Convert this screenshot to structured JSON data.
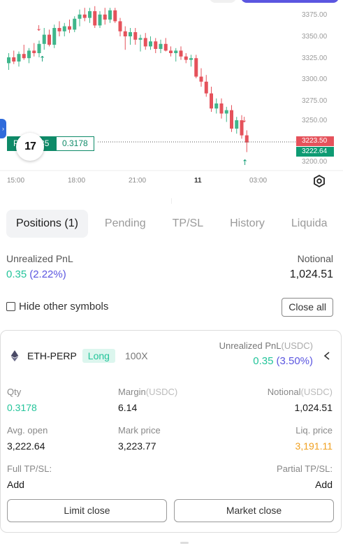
{
  "chart": {
    "price_ticks": [
      "3375.00",
      "3350.00",
      "3325.00",
      "3300.00",
      "3275.00",
      "3250.00",
      "3200.00"
    ],
    "time_ticks": [
      "15:00",
      "18:00",
      "21:00",
      "11",
      "03:00"
    ],
    "mark_price_tag": "3223.50",
    "entry_price_tag": "3222.64",
    "position_label_pnl": "P",
    "position_label_pnl_tail": "35",
    "position_label_qty": "0.3178",
    "logo_text": "17",
    "colors": {
      "up": "#3fb68b",
      "down": "#e5525b"
    },
    "series": [
      {
        "o": 3318,
        "h": 3330,
        "l": 3310,
        "c": 3325
      },
      {
        "o": 3325,
        "h": 3333,
        "l": 3317,
        "c": 3320
      },
      {
        "o": 3320,
        "h": 3332,
        "l": 3314,
        "c": 3329
      },
      {
        "o": 3329,
        "h": 3340,
        "l": 3322,
        "c": 3324
      },
      {
        "o": 3324,
        "h": 3336,
        "l": 3318,
        "c": 3333
      },
      {
        "o": 3333,
        "h": 3342,
        "l": 3326,
        "c": 3330
      },
      {
        "o": 3330,
        "h": 3345,
        "l": 3325,
        "c": 3341
      },
      {
        "o": 3341,
        "h": 3360,
        "l": 3334,
        "c": 3352
      },
      {
        "o": 3352,
        "h": 3358,
        "l": 3338,
        "c": 3340
      },
      {
        "o": 3340,
        "h": 3364,
        "l": 3336,
        "c": 3360
      },
      {
        "o": 3360,
        "h": 3368,
        "l": 3350,
        "c": 3356
      },
      {
        "o": 3356,
        "h": 3366,
        "l": 3350,
        "c": 3362
      },
      {
        "o": 3362,
        "h": 3370,
        "l": 3354,
        "c": 3358
      },
      {
        "o": 3358,
        "h": 3374,
        "l": 3355,
        "c": 3371
      },
      {
        "o": 3371,
        "h": 3382,
        "l": 3362,
        "c": 3376
      },
      {
        "o": 3376,
        "h": 3384,
        "l": 3368,
        "c": 3372
      },
      {
        "o": 3372,
        "h": 3384,
        "l": 3366,
        "c": 3380
      },
      {
        "o": 3380,
        "h": 3386,
        "l": 3360,
        "c": 3363
      },
      {
        "o": 3363,
        "h": 3380,
        "l": 3360,
        "c": 3376
      },
      {
        "o": 3376,
        "h": 3384,
        "l": 3364,
        "c": 3370
      },
      {
        "o": 3370,
        "h": 3384,
        "l": 3366,
        "c": 3381
      },
      {
        "o": 3381,
        "h": 3384,
        "l": 3366,
        "c": 3368
      },
      {
        "o": 3368,
        "h": 3372,
        "l": 3350,
        "c": 3356
      },
      {
        "o": 3356,
        "h": 3362,
        "l": 3334,
        "c": 3350
      },
      {
        "o": 3350,
        "h": 3360,
        "l": 3340,
        "c": 3355
      },
      {
        "o": 3355,
        "h": 3360,
        "l": 3340,
        "c": 3346
      },
      {
        "o": 3346,
        "h": 3352,
        "l": 3332,
        "c": 3348
      },
      {
        "o": 3348,
        "h": 3354,
        "l": 3334,
        "c": 3338
      },
      {
        "o": 3338,
        "h": 3350,
        "l": 3334,
        "c": 3344
      },
      {
        "o": 3344,
        "h": 3348,
        "l": 3330,
        "c": 3335
      },
      {
        "o": 3335,
        "h": 3346,
        "l": 3330,
        "c": 3341
      },
      {
        "o": 3341,
        "h": 3348,
        "l": 3332,
        "c": 3333
      },
      {
        "o": 3333,
        "h": 3338,
        "l": 3326,
        "c": 3330
      },
      {
        "o": 3330,
        "h": 3336,
        "l": 3320,
        "c": 3333
      },
      {
        "o": 3333,
        "h": 3338,
        "l": 3322,
        "c": 3326
      },
      {
        "o": 3326,
        "h": 3330,
        "l": 3318,
        "c": 3322
      },
      {
        "o": 3322,
        "h": 3328,
        "l": 3314,
        "c": 3324
      },
      {
        "o": 3324,
        "h": 3328,
        "l": 3300,
        "c": 3302
      },
      {
        "o": 3302,
        "h": 3312,
        "l": 3290,
        "c": 3296
      },
      {
        "o": 3296,
        "h": 3304,
        "l": 3278,
        "c": 3282
      },
      {
        "o": 3282,
        "h": 3290,
        "l": 3260,
        "c": 3264
      },
      {
        "o": 3264,
        "h": 3276,
        "l": 3258,
        "c": 3270
      },
      {
        "o": 3270,
        "h": 3276,
        "l": 3252,
        "c": 3258
      },
      {
        "o": 3258,
        "h": 3266,
        "l": 3248,
        "c": 3262
      },
      {
        "o": 3262,
        "h": 3268,
        "l": 3236,
        "c": 3240
      },
      {
        "o": 3240,
        "h": 3254,
        "l": 3234,
        "c": 3250
      },
      {
        "o": 3250,
        "h": 3256,
        "l": 3228,
        "c": 3232
      },
      {
        "o": 3232,
        "h": 3238,
        "l": 3212,
        "c": 3223.5
      }
    ]
  },
  "tabs": [
    "Positions (1)",
    "Pending",
    "TP/SL",
    "History",
    "Liquida"
  ],
  "summary": {
    "upnl_label": "Unrealized PnL",
    "upnl_value": "0.35",
    "upnl_pct": "(2.22%)",
    "notional_label": "Notional",
    "notional_value": "1,024.51",
    "hide_label": "Hide other symbols",
    "close_all": "Close all"
  },
  "position": {
    "symbol": "ETH-PERP",
    "side": "Long",
    "leverage": "100X",
    "upnl_label": "Unrealized PnL",
    "upnl_unit": "(USDC)",
    "upnl_value": "0.35",
    "upnl_pct": "(3.50%)",
    "qty_label": "Qty",
    "qty_value": "0.3178",
    "margin_label": "Margin",
    "margin_unit": "(USDC)",
    "margin_value": "6.14",
    "notional_label": "Notional",
    "notional_unit": "(USDC)",
    "notional_value": "1,024.51",
    "avg_open_label": "Avg. open",
    "avg_open_value": "3,222.64",
    "mark_price_label": "Mark price",
    "mark_price_value": "3,223.77",
    "liq_price_label": "Liq. price",
    "liq_price_value": "3,191.11",
    "full_tpsl_label": "Full TP/SL:",
    "full_tpsl_value": "Add",
    "partial_tpsl_label": "Partial TP/SL:",
    "partial_tpsl_value": "Add",
    "limit_close": "Limit close",
    "market_close": "Market close"
  }
}
